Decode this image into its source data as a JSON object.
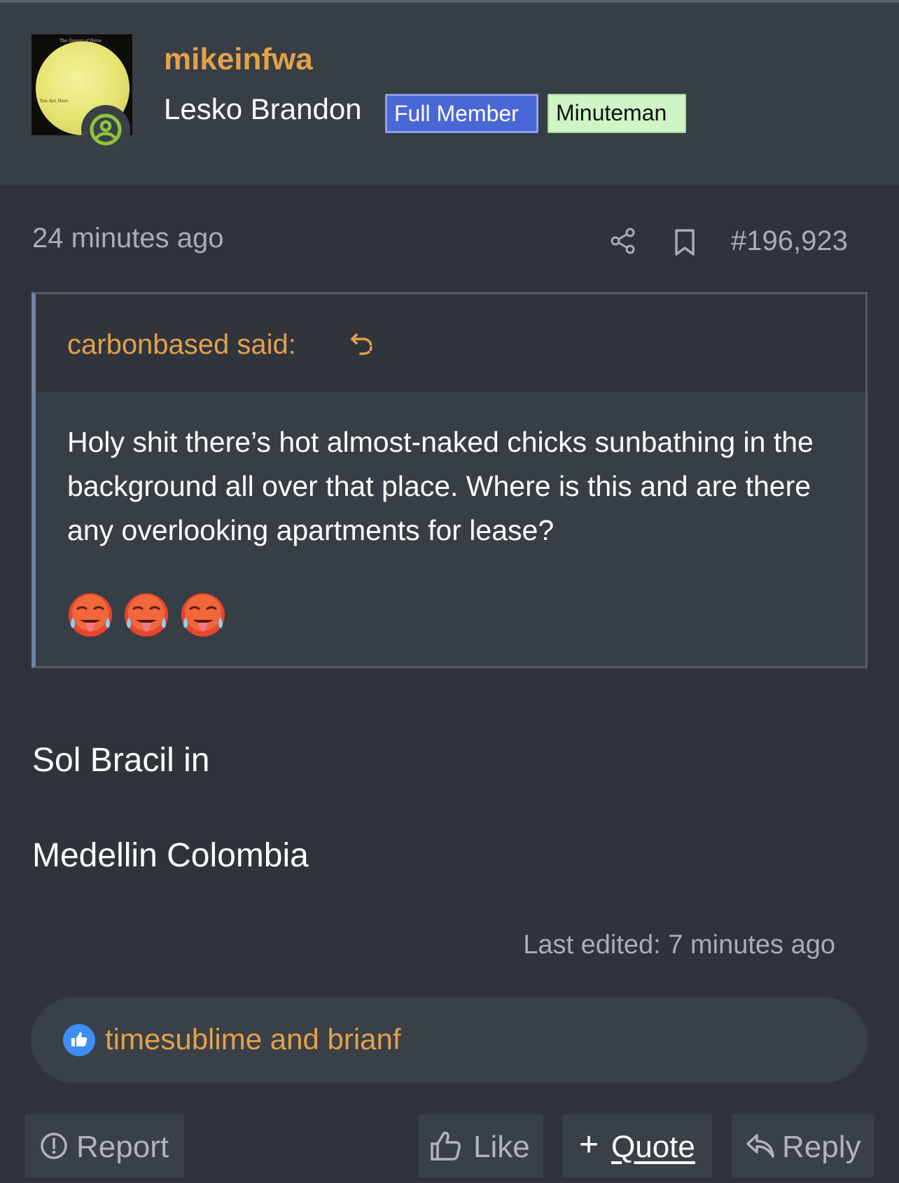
{
  "post": {
    "username": "mikeinfwa",
    "user_title": "Lesko Brandon",
    "badges": [
      "Full Member",
      "Minuteman"
    ],
    "timestamp": "24 minutes ago",
    "post_number": "#196,923",
    "quote": {
      "author": "carbonbased said:",
      "text": "Holy shit there’s hot almost-naked chicks sunbathing in the background all over that place. Where is this and are there any overlooking apartments for lease?",
      "emojis": [
        "hot-face-emoji",
        "hot-face-emoji",
        "hot-face-emoji"
      ]
    },
    "body": [
      "Sol Bracil in",
      "Medellin Colombia"
    ],
    "last_edited": "Last edited: 7 minutes ago",
    "reactions": {
      "icon": "thumbs-up-icon",
      "users": "timesublime and brianf"
    },
    "actions": {
      "report": "Report",
      "like": "Like",
      "quote": "Quote",
      "reply": "Reply"
    },
    "avatar": {
      "caption": "The Gospel of Nova",
      "label": "You Are Here"
    }
  },
  "colors": {
    "background": "#2f343c",
    "header": "#383e46",
    "accent": "#e3a14a",
    "badge_full_member": "#4a67d6",
    "badge_minuteman": "#cff5c6",
    "online_status": "#8fc43c",
    "like_bubble": "#3d8df2"
  }
}
